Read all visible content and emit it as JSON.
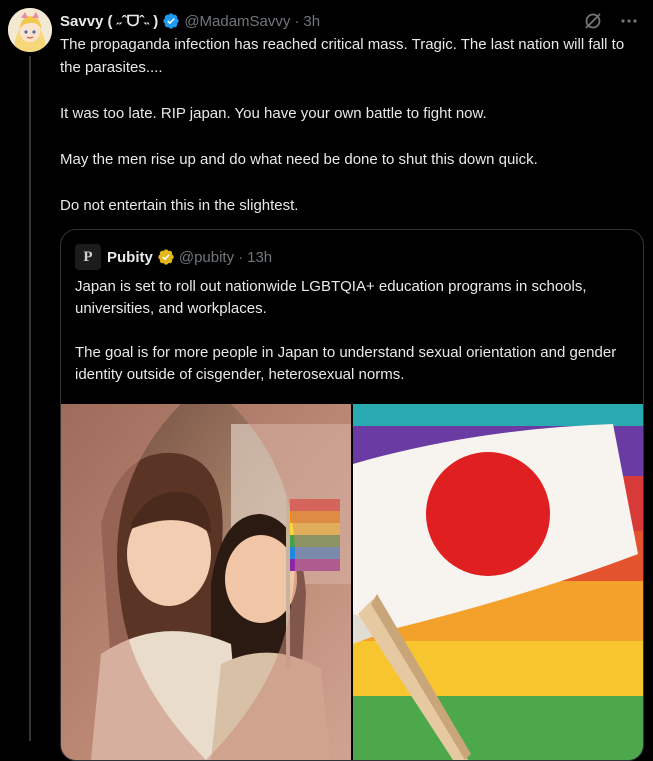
{
  "post": {
    "author_name": "Savvy ( ˶ˆᗜˆ˵ )",
    "handle": "@MadamSavvy",
    "separator": "·",
    "time": "3h",
    "paragraphs": [
      "The propaganda infection has reached critical mass. Tragic. The last nation will fall to the parasites....",
      "It was too late. RIP japan. You have your own battle to fight now.",
      "May the men rise up and do what need be done to shut this down quick.",
      "Do not entertain this in the slightest."
    ],
    "icons": [
      "grok-icon",
      "more-options-icon"
    ]
  },
  "quoted": {
    "author_name": "Pubity",
    "handle": "@pubity",
    "separator": "·",
    "time": "13h",
    "avatar_letter": "P",
    "paragraphs": [
      "Japan is set to roll out nationwide LGBTQIA+ education programs in schools, universities, and workplaces.",
      "The goal is for more people in Japan to understand sexual orientation and gender identity outside of cisgender, heterosexual norms."
    ]
  },
  "colors": {
    "background": "#000000",
    "text": "#e7e9ea",
    "muted": "#71767b",
    "verified_blue": "#1d9bf0",
    "verified_gold": "#e2b719",
    "border": "#2f3336"
  }
}
